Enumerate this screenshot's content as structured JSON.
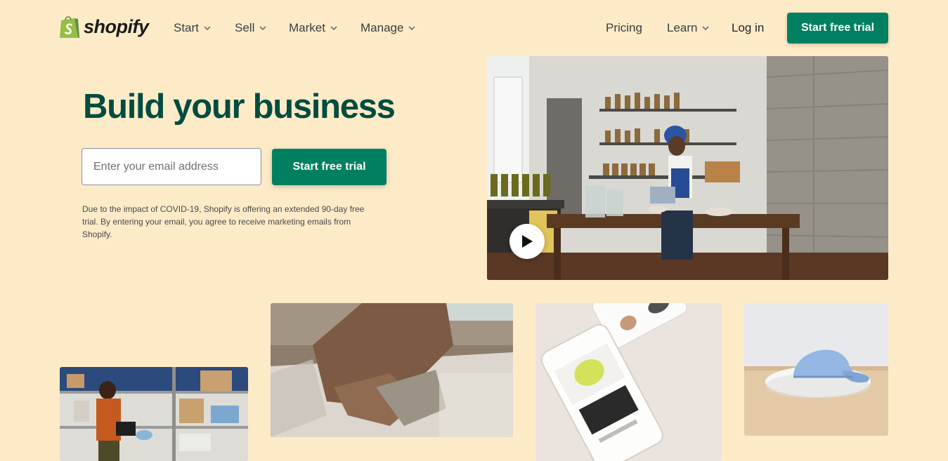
{
  "brand": {
    "name": "shopify",
    "accent": "#008060",
    "heading_color": "#004c3f",
    "background": "#fdebc8"
  },
  "nav": {
    "left": [
      {
        "label": "Start",
        "icon": "chevron-down-icon"
      },
      {
        "label": "Sell",
        "icon": "chevron-down-icon"
      },
      {
        "label": "Market",
        "icon": "chevron-down-icon"
      },
      {
        "label": "Manage",
        "icon": "chevron-down-icon"
      }
    ],
    "right": [
      {
        "label": "Pricing"
      },
      {
        "label": "Learn",
        "icon": "chevron-down-icon"
      },
      {
        "label": "Log in"
      }
    ],
    "cta": "Start free trial"
  },
  "hero": {
    "title": "Build your business",
    "email_placeholder": "Enter your email address",
    "email_value": "",
    "cta": "Start free trial",
    "disclaimer": "Due to the impact of COVID-19, Shopify is offering an extended 90-day free trial. By entering your email, you agree to receive marketing emails from Shopify.",
    "video": {
      "icon": "play-icon"
    }
  }
}
